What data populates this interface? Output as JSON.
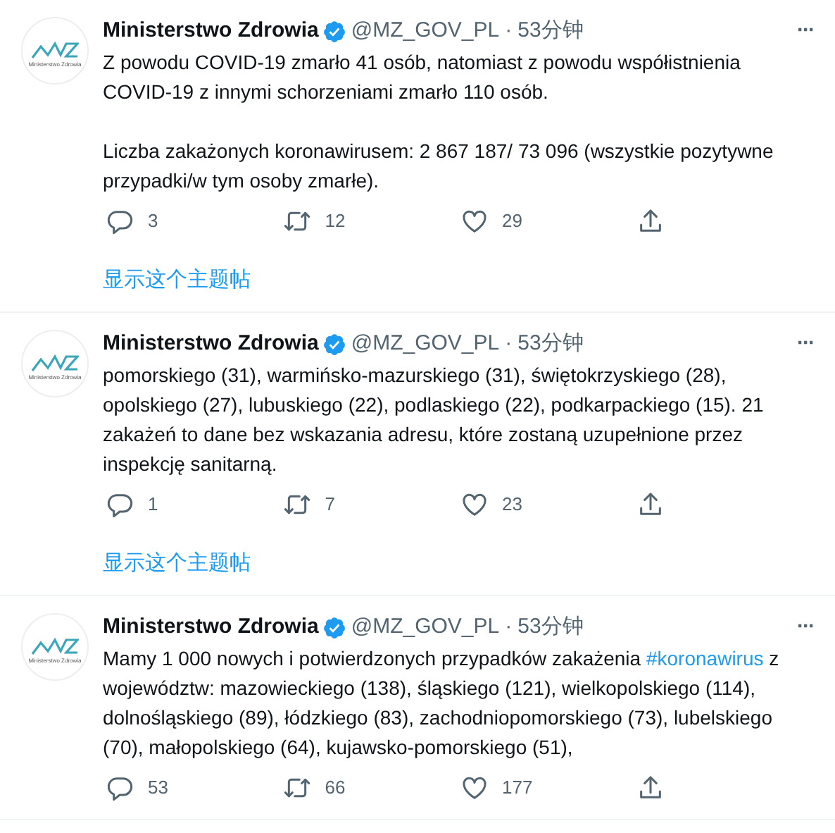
{
  "tweets": [
    {
      "avatar_caption": "Ministerstwo Zdrowia",
      "name": "Ministerstwo Zdrowia",
      "verified": true,
      "handle": "@MZ_GOV_PL",
      "separator": "·",
      "time": "53分钟",
      "more": "···",
      "paragraphs": [
        [
          {
            "text": "Z powodu COVID-19 zmarło 41 osób, natomiast z powodu współistnienia COVID-19 z innymi schorzeniami zmarło 110 osób."
          }
        ],
        [
          {
            "text": "Liczba zakażonych koronawirusem: 2 867 187/ 73 096 (wszystkie pozytywne przypadki/w tym osoby zmarłe)."
          }
        ]
      ],
      "replies": "3",
      "retweets": "12",
      "likes": "29",
      "thread_link": "显示这个主题帖"
    },
    {
      "avatar_caption": "Ministerstwo Zdrowia",
      "name": "Ministerstwo Zdrowia",
      "verified": true,
      "handle": "@MZ_GOV_PL",
      "separator": "·",
      "time": "53分钟",
      "more": "···",
      "paragraphs": [
        [
          {
            "text": "pomorskiego (31), warmińsko-mazurskiego (31), świętokrzyskiego (28), opolskiego (27), lubuskiego (22), podlaskiego (22), podkarpackiego (15). 21 zakażeń to dane bez wskazania adresu, które zostaną uzupełnione przez inspekcję sanitarną."
          }
        ]
      ],
      "replies": "1",
      "retweets": "7",
      "likes": "23",
      "thread_link": "显示这个主题帖"
    },
    {
      "avatar_caption": "Ministerstwo Zdrowia",
      "name": "Ministerstwo Zdrowia",
      "verified": true,
      "handle": "@MZ_GOV_PL",
      "separator": "·",
      "time": "53分钟",
      "more": "···",
      "paragraphs": [
        [
          {
            "text": "Mamy 1 000 nowych i potwierdzonych przypadków zakażenia "
          },
          {
            "text": "#koronawirus",
            "kind": "hashtag"
          },
          {
            "text": " z województw: mazowieckiego (138), śląskiego (121), wielkopolskiego (114), dolnośląskiego (89), łódzkiego (83), zachodniopomorskiego (73), lubelskiego (70), małopolskiego (64), kujawsko-pomorskiego (51),"
          }
        ]
      ],
      "replies": "53",
      "retweets": "66",
      "likes": "177"
    }
  ]
}
